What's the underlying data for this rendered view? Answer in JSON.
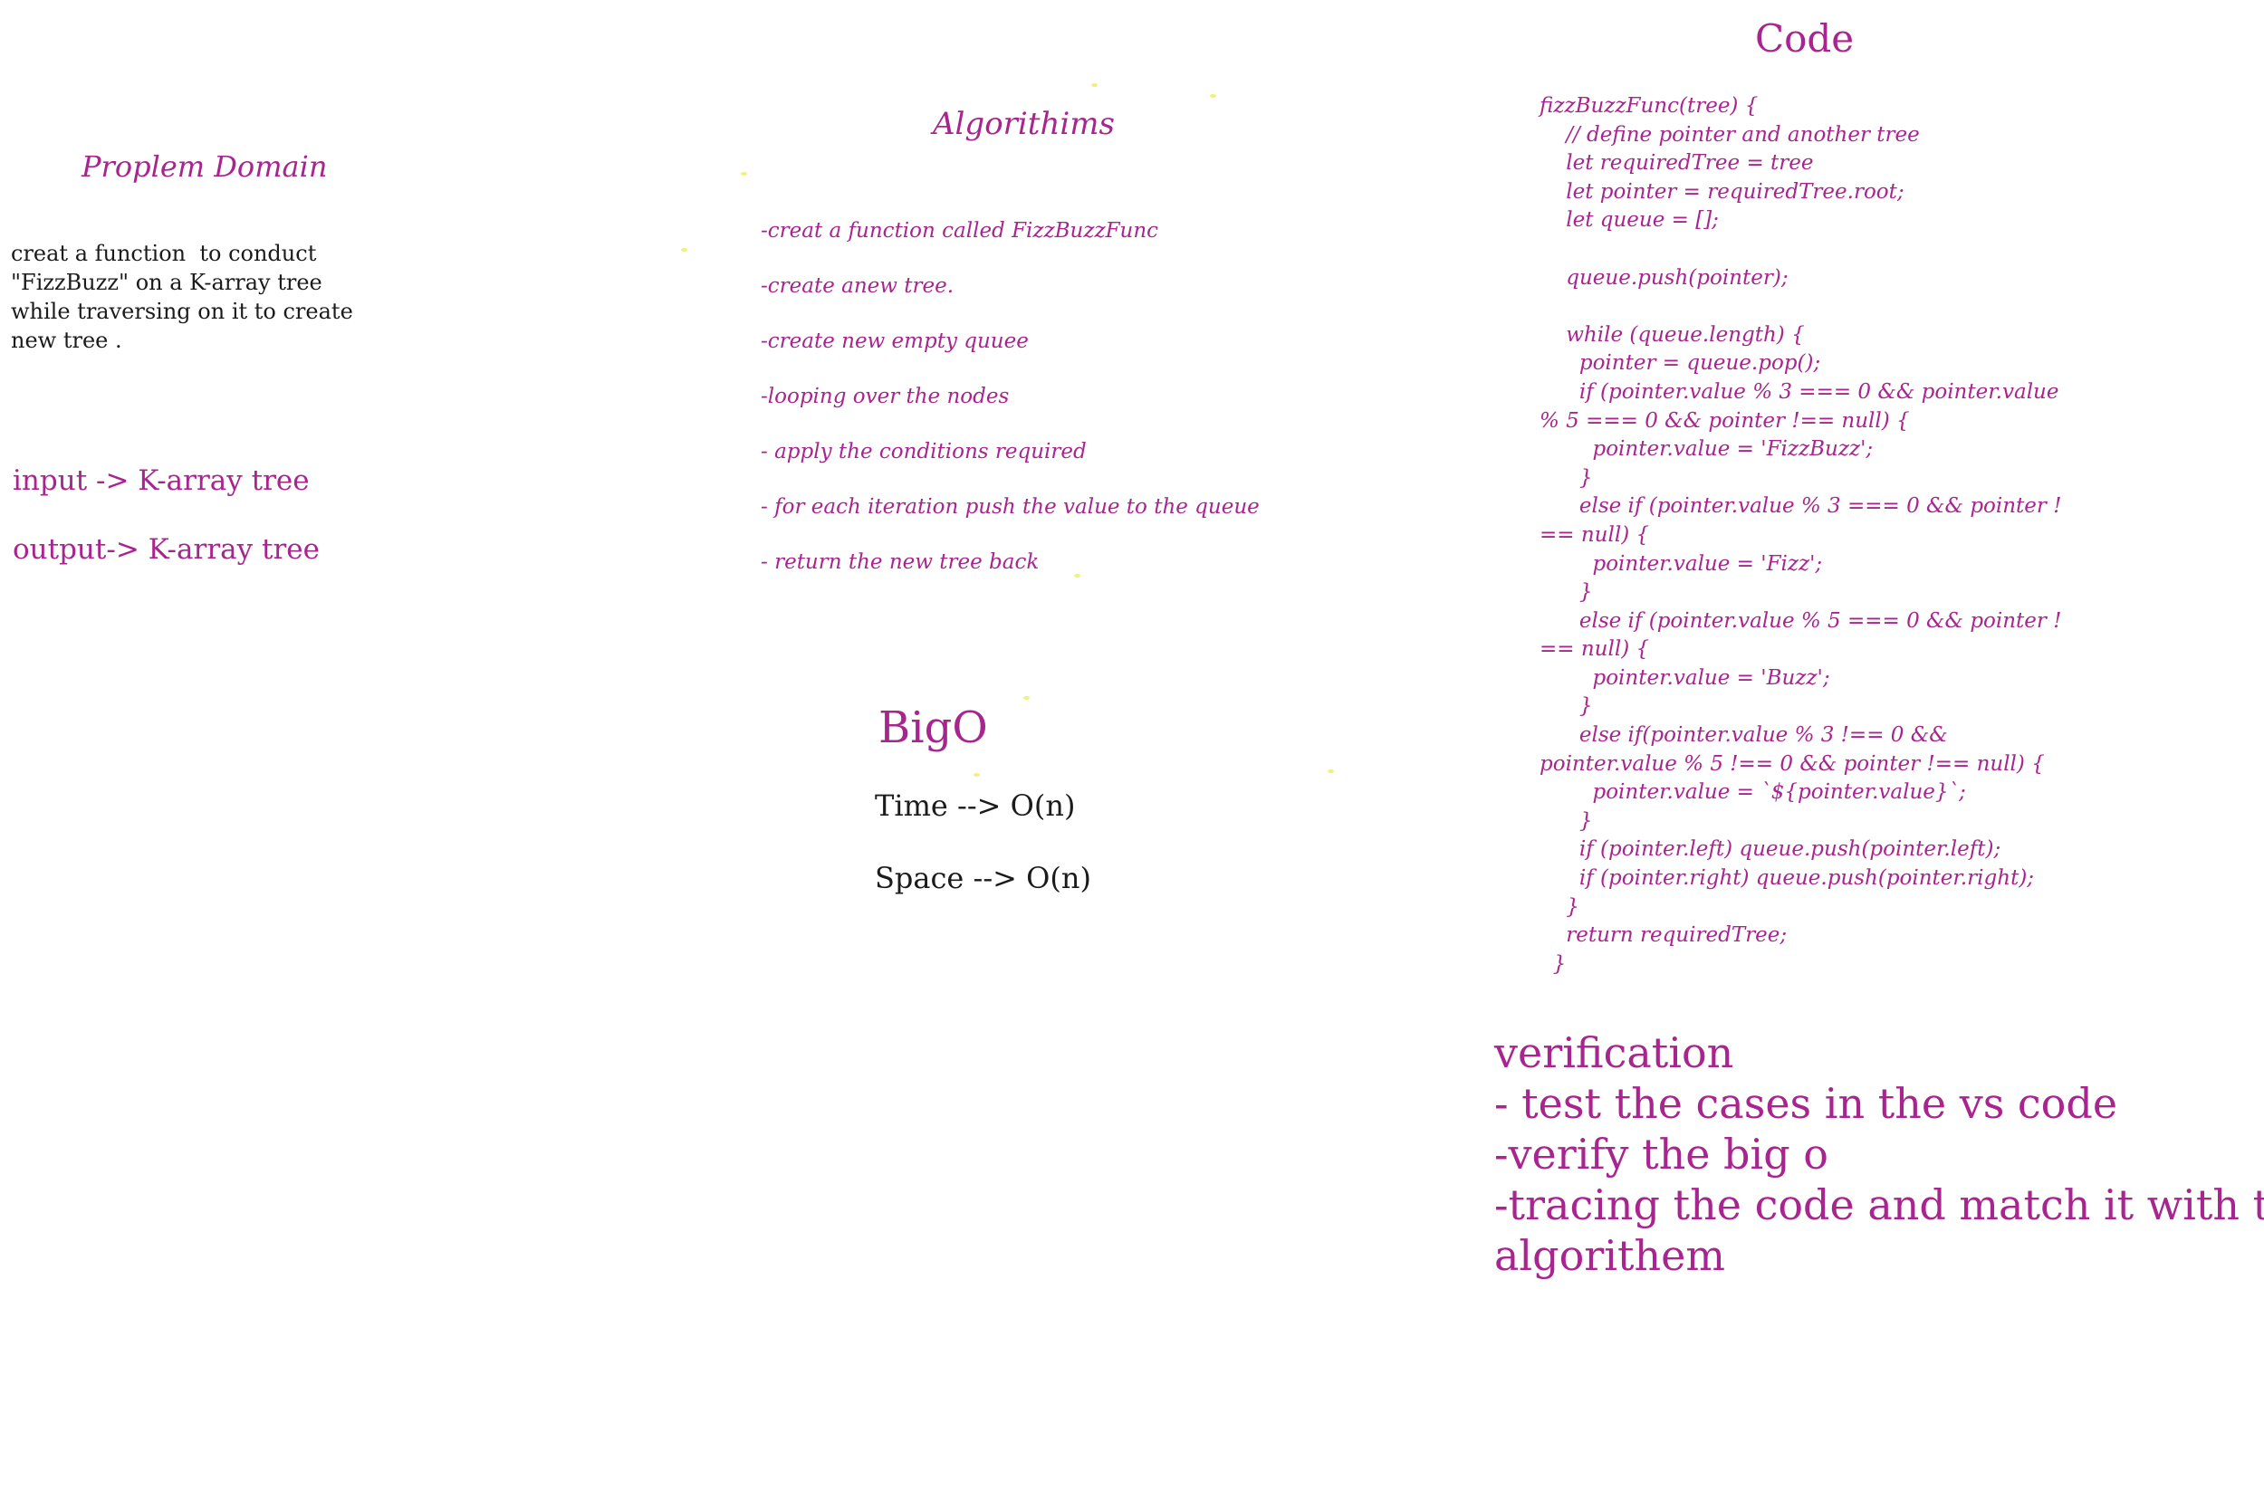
{
  "problem": {
    "title": "Proplem Domain",
    "description": [
      "creat a function  to conduct",
      "\"FizzBuzz\" on a K-array tree",
      "while traversing on it to create",
      "new tree ."
    ],
    "input": "input -> K-array tree",
    "output": "output-> K-array tree"
  },
  "algorithm": {
    "title": "Algorithims",
    "steps": [
      "-creat a function called FizzBuzzFunc",
      "-create anew tree.",
      "-create new empty quuee",
      "-looping over the nodes",
      "- apply the conditions required",
      "- for each iteration push the value to the queue",
      "- return the new tree back"
    ]
  },
  "bigo": {
    "title": "BigO",
    "time": "Time --> O(n)",
    "space": "Space --> O(n)"
  },
  "code": {
    "title": "Code",
    "lines": [
      "fizzBuzzFunc(tree) {",
      "    // define pointer and another tree",
      "    let requiredTree = tree",
      "    let pointer = requiredTree.root;",
      "    let queue = [];",
      "",
      "    queue.push(pointer);",
      "",
      "    while (queue.length) {",
      "      pointer = queue.pop();",
      "      if (pointer.value % 3 === 0 && pointer.value",
      "% 5 === 0 && pointer !== null) {",
      "        pointer.value = 'FizzBuzz';",
      "      }",
      "      else if (pointer.value % 3 === 0 && pointer !",
      "== null) {",
      "        pointer.value = 'Fizz';",
      "      }",
      "      else if (pointer.value % 5 === 0 && pointer !",
      "== null) {",
      "        pointer.value = 'Buzz';",
      "      }",
      "      else if(pointer.value % 3 !== 0 &&",
      "pointer.value % 5 !== 0 && pointer !== null) {",
      "        pointer.value = `${pointer.value}`;",
      "      }",
      "      if (pointer.left) queue.push(pointer.left);",
      "      if (pointer.right) queue.push(pointer.right);",
      "    }",
      "    return requiredTree;",
      "  }"
    ]
  },
  "verification": {
    "lines": [
      "verification",
      "- test the cases in the vs code",
      "-verify the big o",
      "-tracing the code and match it with the",
      "algorithem"
    ]
  },
  "colors": {
    "accent": "#a8258f",
    "text": "#1b1b1b",
    "highlight_dots": "#f3f07a"
  }
}
